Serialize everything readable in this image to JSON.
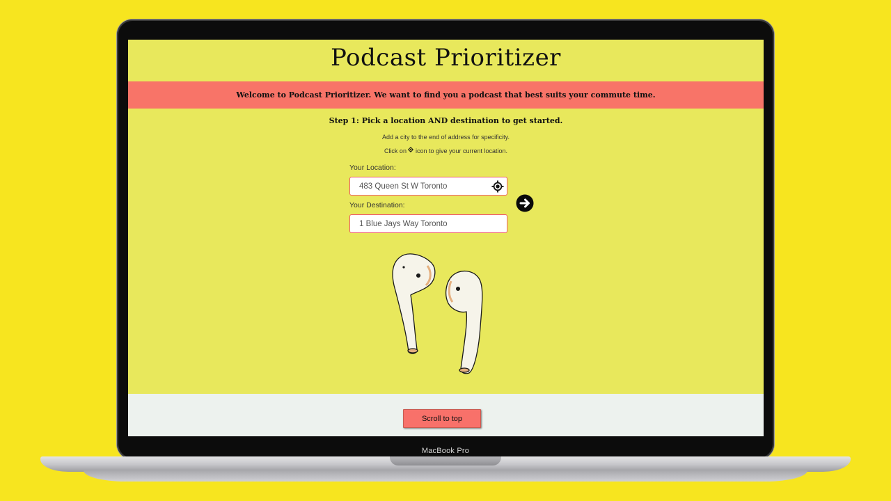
{
  "page": {
    "title": "Podcast Prioritizer",
    "welcome": "Welcome to Podcast Prioritizer. We want to find you a podcast that best suits your commute time.",
    "step": "Step 1: Pick a location AND destination to get started.",
    "hint_line1": "Add a city to the end of address for specificity.",
    "hint_line2_prefix": "Click on",
    "hint_line2_suffix": "icon to give your current location."
  },
  "form": {
    "location_label": "Your Location:",
    "location_value": "483 Queen St W Toronto",
    "destination_label": "Your Destination:",
    "destination_value": "1 Blue Jays Way Toronto",
    "locate_icon": "crosshair-icon",
    "submit_icon": "arrow-right-circle-icon"
  },
  "footer": {
    "scroll_top_label": "Scroll to top"
  },
  "device": {
    "label": "MacBook Pro"
  },
  "colors": {
    "background": "#f7e51f",
    "page_background": "#e8e85c",
    "banner": "#f87468",
    "footer": "#edf2ee",
    "input_border": "#ef5a6a",
    "button": "#f8716a"
  }
}
